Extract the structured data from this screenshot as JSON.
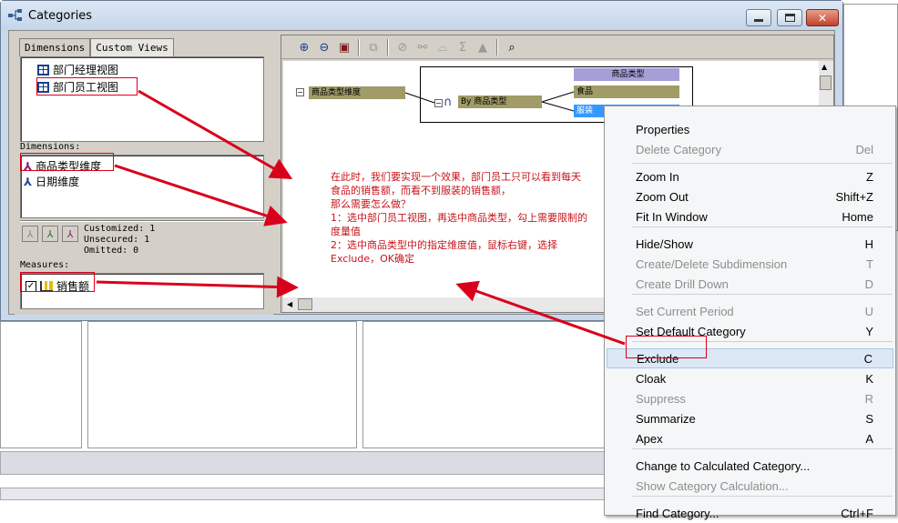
{
  "window": {
    "title": "Categories"
  },
  "left_pane": {
    "tabs": [
      {
        "label": "Dimensions"
      },
      {
        "label": "Custom Views"
      }
    ],
    "views": [
      {
        "label": "部门经理视图"
      },
      {
        "label": "部门员工视图"
      }
    ],
    "dimensions_label": "Dimensions:",
    "dimensions": [
      {
        "label": "商品类型维度"
      },
      {
        "label": "日期维度"
      }
    ],
    "security_counts": {
      "customized": "Customized: 1",
      "unsecured": "Unsecured: 1",
      "omitted": "Omitted: 0"
    },
    "measures_label": "Measures:",
    "measures": [
      {
        "label": "销售额",
        "checked": true
      }
    ]
  },
  "canvas": {
    "root_node": "商品类型维度",
    "level_node": "By 商品类型",
    "level_header": "商品类型",
    "categories": [
      {
        "label": "食品"
      },
      {
        "label": "服装"
      }
    ]
  },
  "annotation": {
    "lines": [
      "在此时，我们要实现一个效果，部门员工只可以看到每天",
      "食品的销售额，而看不到服装的销售额，",
      "那么需要怎么做？",
      "1：选中部门员工视图，再选中商品类型，勾上需要限制的",
      "度量值",
      "2：选中商品类型中的指定维度值，鼠标右键，选择",
      "Exclude，OK确定"
    ]
  },
  "context_menu": {
    "items": [
      {
        "label": "Properties",
        "shortcut": "",
        "enabled": true
      },
      {
        "label": "Delete Category",
        "shortcut": "Del",
        "enabled": false
      },
      {
        "label": "Zoom In",
        "shortcut": "Z",
        "enabled": true
      },
      {
        "label": "Zoom Out",
        "shortcut": "Shift+Z",
        "enabled": true
      },
      {
        "label": "Fit In Window",
        "shortcut": "Home",
        "enabled": true
      },
      {
        "label": "Hide/Show",
        "shortcut": "H",
        "enabled": true
      },
      {
        "label": "Create/Delete Subdimension",
        "shortcut": "T",
        "enabled": false
      },
      {
        "label": "Create Drill Down",
        "shortcut": "D",
        "enabled": false
      },
      {
        "label": "Set Current Period",
        "shortcut": "U",
        "enabled": false
      },
      {
        "label": "Set Default Category",
        "shortcut": "Y",
        "enabled": true
      },
      {
        "label": "Exclude",
        "shortcut": "C",
        "enabled": true
      },
      {
        "label": "Cloak",
        "shortcut": "K",
        "enabled": true
      },
      {
        "label": "Suppress",
        "shortcut": "R",
        "enabled": false
      },
      {
        "label": "Summarize",
        "shortcut": "S",
        "enabled": true
      },
      {
        "label": "Apex",
        "shortcut": "A",
        "enabled": true
      },
      {
        "label": "Change to Calculated Category...",
        "shortcut": "",
        "enabled": true
      },
      {
        "label": "Show Category Calculation...",
        "shortcut": "",
        "enabled": false
      },
      {
        "label": "Find Category...",
        "shortcut": "Ctrl+F",
        "enabled": true
      }
    ]
  },
  "colors": {
    "annotation_red": "#d9001b",
    "node_olive": "#a09b67",
    "header_purple": "#a59fd8",
    "selected_blue": "#3399ff"
  }
}
